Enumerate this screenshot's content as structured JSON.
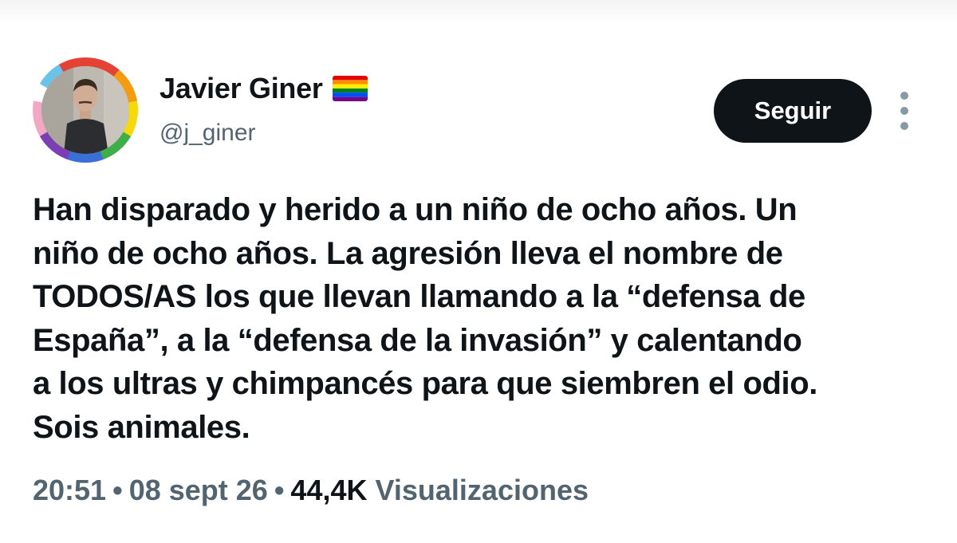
{
  "author": {
    "display_name": "Javier Giner",
    "handle": "@j_giner",
    "badge_icon": "rainbow-flag-icon",
    "avatar_ring_colors": [
      "#e34234",
      "#f39c12",
      "#f5d90a",
      "#3fae49",
      "#3a6fd8",
      "#7b3fb3",
      "#f2a7c3",
      "#ffffff",
      "#6cc3ea"
    ]
  },
  "actions": {
    "follow_label": "Seguir",
    "more_icon": "more-vertical-icon"
  },
  "tweet": {
    "lines": [
      "Han disparado y herido a un niño de ocho años. Un",
      "niño de ocho años. La agresión lleva el nombre de",
      "TODOS/AS los que llevan llamando a la “defensa de",
      "España”, a la “defensa de la invasión” y calentando",
      "a los ultras y chimpancés para que siembren el odio.",
      "Sois animales."
    ]
  },
  "meta": {
    "time": "20:51",
    "separator": "•",
    "date": "08 sept 26",
    "views_count": "44,4K",
    "views_label": "Visualizaciones"
  },
  "colors": {
    "text_primary": "#0f1419",
    "text_secondary": "#536471",
    "button_bg": "#0f1419",
    "button_text": "#ffffff"
  }
}
